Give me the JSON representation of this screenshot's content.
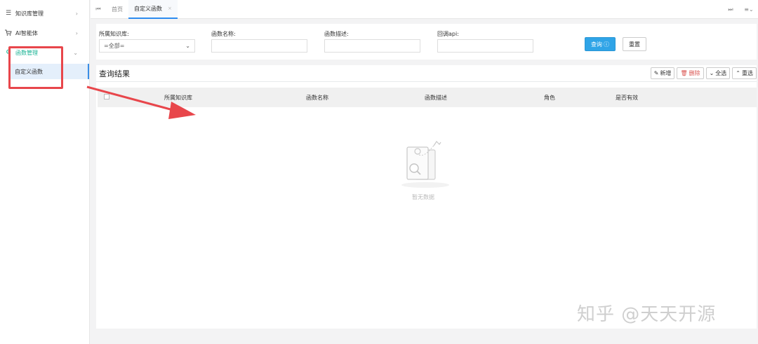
{
  "sidebar": {
    "items": [
      {
        "label": "知识库管理",
        "icon": "list-icon"
      },
      {
        "label": "AI智能体",
        "icon": "cart-icon"
      },
      {
        "label": "函数管理",
        "icon": "gear-icon"
      }
    ],
    "sub_items": [
      {
        "label": "自定义函数"
      }
    ]
  },
  "tabs": {
    "items": [
      {
        "label": "首页"
      },
      {
        "label": "自定义函数"
      }
    ]
  },
  "search": {
    "kb_label": "所属知识库:",
    "kb_value": "=全部=",
    "name_label": "函数名称:",
    "desc_label": "函数描述:",
    "api_label": "回调api:",
    "query_button": "查询",
    "reset_button": "重置"
  },
  "results": {
    "title": "查询结果",
    "tools": {
      "add": "新增",
      "delete": "删除",
      "select_all": "全选",
      "reselect": "重选"
    },
    "columns": [
      "所属知识库",
      "函数名称",
      "函数描述",
      "角色",
      "是否有效"
    ],
    "empty_text": "暂无数据"
  },
  "watermark": "知乎 @天天开源",
  "colors": {
    "accent": "#2fa4e7",
    "active_menu": "#1ab394",
    "annotation": "#e8464b",
    "tab_underline": "#2d8cf0"
  }
}
